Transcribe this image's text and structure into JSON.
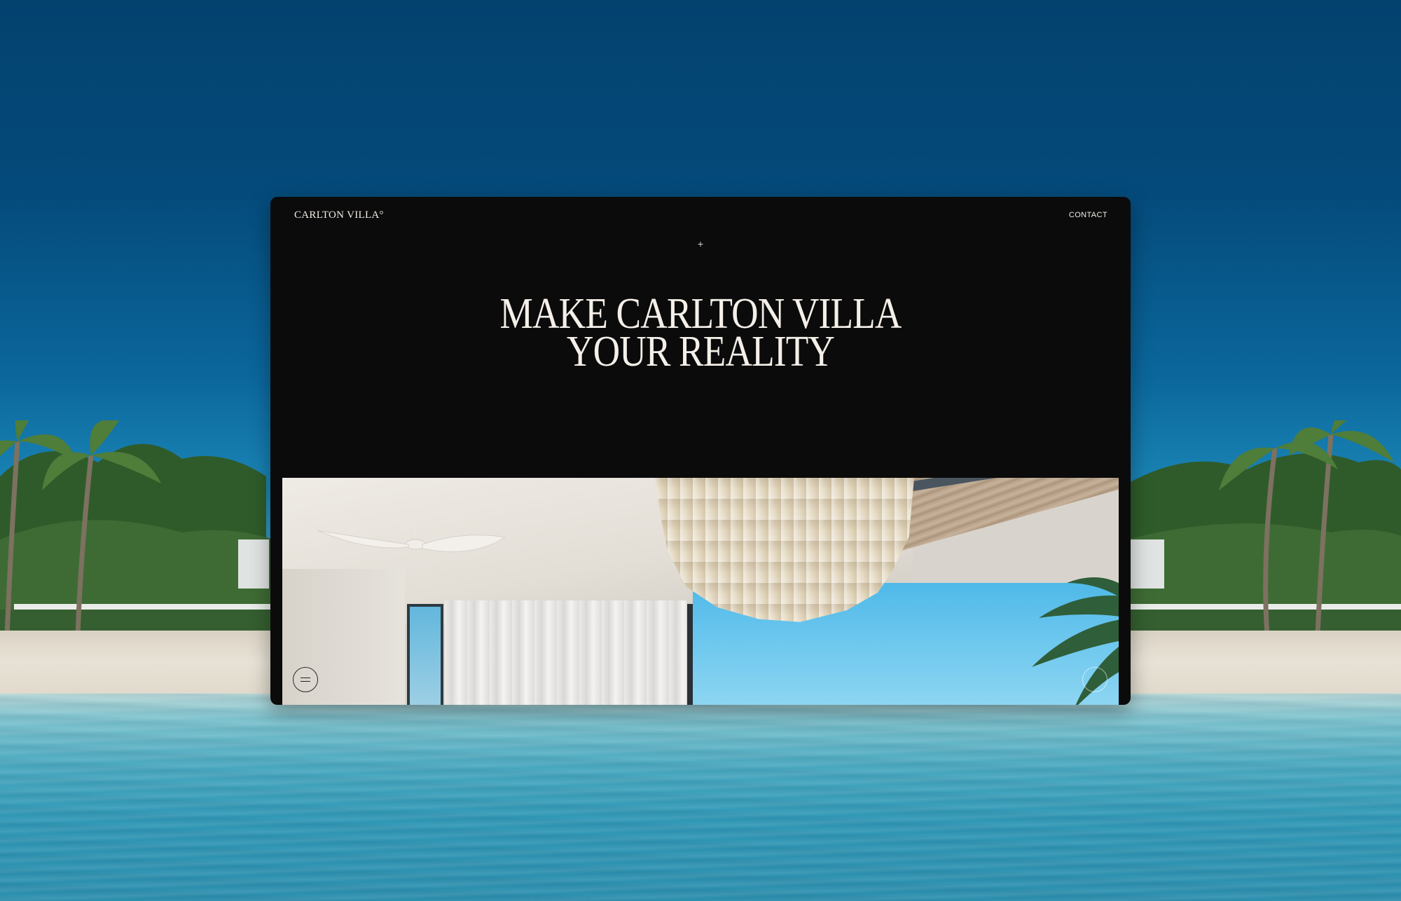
{
  "header": {
    "logo_text": "CARLTON VILLA°",
    "contact_label": "CONTACT"
  },
  "hero": {
    "plus_glyph": "+",
    "heading_line1": "MAKE CARLTON VILLA",
    "heading_line2": "YOUR REALITY"
  },
  "icons": {
    "plus": "plus-icon",
    "menu": "hamburger-menu-icon",
    "scroll": "circle-icon"
  },
  "colors": {
    "window_bg": "#0b0b0b",
    "heading_text": "#f4efe8",
    "sky": "#044a7a",
    "water": "#49a9c0"
  }
}
